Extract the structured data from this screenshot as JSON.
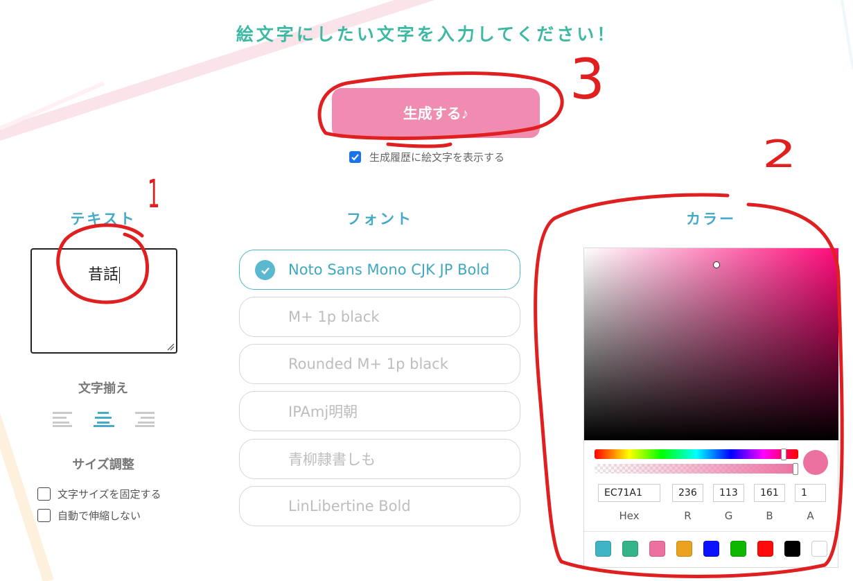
{
  "headline": "絵文字にしたい文字を入力してください！",
  "generate_button": "生成する♪",
  "history_checkbox": {
    "label": "生成履歴に絵文字を表示する",
    "checked": true
  },
  "annotations": {
    "one": "1",
    "two": "2",
    "three": "3"
  },
  "text_section": {
    "title": "テキスト",
    "value": "昔話",
    "alignment_title": "文字揃え",
    "alignment": "center",
    "size_title": "サイズ調整",
    "options": [
      {
        "label": "文字サイズを固定する",
        "checked": false
      },
      {
        "label": "自動で伸縮しない",
        "checked": false
      }
    ]
  },
  "font_section": {
    "title": "フォント",
    "fonts": [
      {
        "label": "Noto Sans Mono CJK JP Bold",
        "selected": true
      },
      {
        "label": "M+ 1p black",
        "selected": false
      },
      {
        "label": "Rounded M+ 1p black",
        "selected": false
      },
      {
        "label": "IPAmj明朝",
        "selected": false
      },
      {
        "label": "青柳隷書しも",
        "selected": false
      },
      {
        "label": "LinLibertine Bold",
        "selected": false
      }
    ]
  },
  "color_section": {
    "title": "カラー",
    "hex": "EC71A1",
    "r": "236",
    "g": "113",
    "b": "161",
    "a": "1",
    "labels": {
      "hex": "Hex",
      "r": "R",
      "g": "G",
      "b": "B",
      "a": "A"
    },
    "current_color": "#ec71a1",
    "hue_level": 0.93,
    "alpha_level": 1.0,
    "swatches": [
      "#3fb4c6",
      "#35b48a",
      "#ec71a1",
      "#eaa21f",
      "#0a12ff",
      "#0fb800",
      "#ff0a0a",
      "#000000",
      "#ffffff"
    ]
  },
  "colors": {
    "accent_teal": "#3db8a3",
    "accent_blue": "#47a9c8",
    "pink_button": "#f08cb2",
    "annotation_red": "#e02020"
  }
}
